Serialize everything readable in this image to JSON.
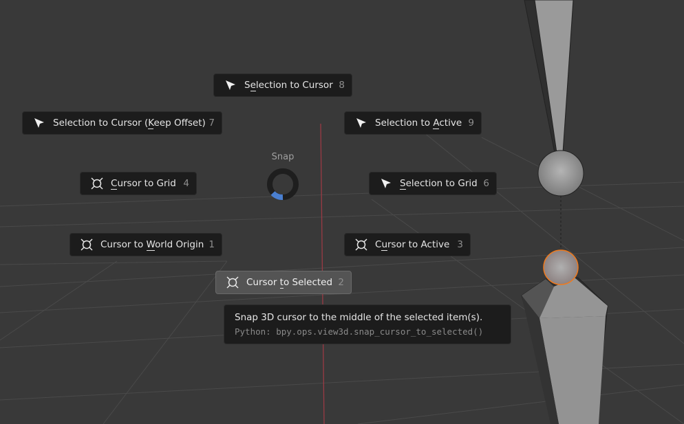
{
  "pie_menu": {
    "title": "Snap",
    "items": [
      {
        "id": "selection-to-cursor",
        "pre": "S",
        "ul": "e",
        "post": "lection to Cursor",
        "label": "Selection to Cursor",
        "shortcut": "8",
        "icon": "arrow-cursor-icon"
      },
      {
        "id": "selection-to-cursor-keep-offset",
        "pre": "Selection to Cursor (",
        "ul": "K",
        "post": "eep Offset)",
        "label": "Selection to Cursor (Keep Offset)",
        "shortcut": "7",
        "icon": "arrow-cursor-icon"
      },
      {
        "id": "selection-to-active",
        "pre": "Selection to ",
        "ul": "A",
        "post": "ctive",
        "label": "Selection to Active",
        "shortcut": "9",
        "icon": "arrow-cursor-icon"
      },
      {
        "id": "cursor-to-grid",
        "pre": "",
        "ul": "C",
        "post": "ursor to Grid",
        "label": "Cursor to Grid",
        "shortcut": "4",
        "icon": "3d-cursor-icon"
      },
      {
        "id": "selection-to-grid",
        "pre": "",
        "ul": "S",
        "post": "election to Grid",
        "label": "Selection to Grid",
        "shortcut": "6",
        "icon": "arrow-cursor-icon"
      },
      {
        "id": "cursor-to-world-origin",
        "pre": "Cursor to ",
        "ul": "W",
        "post": "orld Origin",
        "label": "Cursor to World Origin",
        "shortcut": "1",
        "icon": "3d-cursor-icon"
      },
      {
        "id": "cursor-to-active",
        "pre": "C",
        "ul": "u",
        "post": "rsor to Active",
        "label": "Cursor to Active",
        "shortcut": "3",
        "icon": "3d-cursor-icon"
      },
      {
        "id": "cursor-to-selected",
        "pre": "Cursor ",
        "ul": "t",
        "post": "o Selected",
        "label": "Cursor to Selected",
        "shortcut": "2",
        "icon": "3d-cursor-icon",
        "highlighted": true
      }
    ]
  },
  "tooltip": {
    "description": "Snap 3D cursor to the middle of the selected item(s).",
    "python": "Python: bpy.ops.view3d.snap_cursor_to_selected()"
  },
  "colors": {
    "viewport_bg": "#393939",
    "x_axis": "#9a3a44",
    "selection_outline": "#f07a1c",
    "pie_direction": "#4a7fd0"
  }
}
